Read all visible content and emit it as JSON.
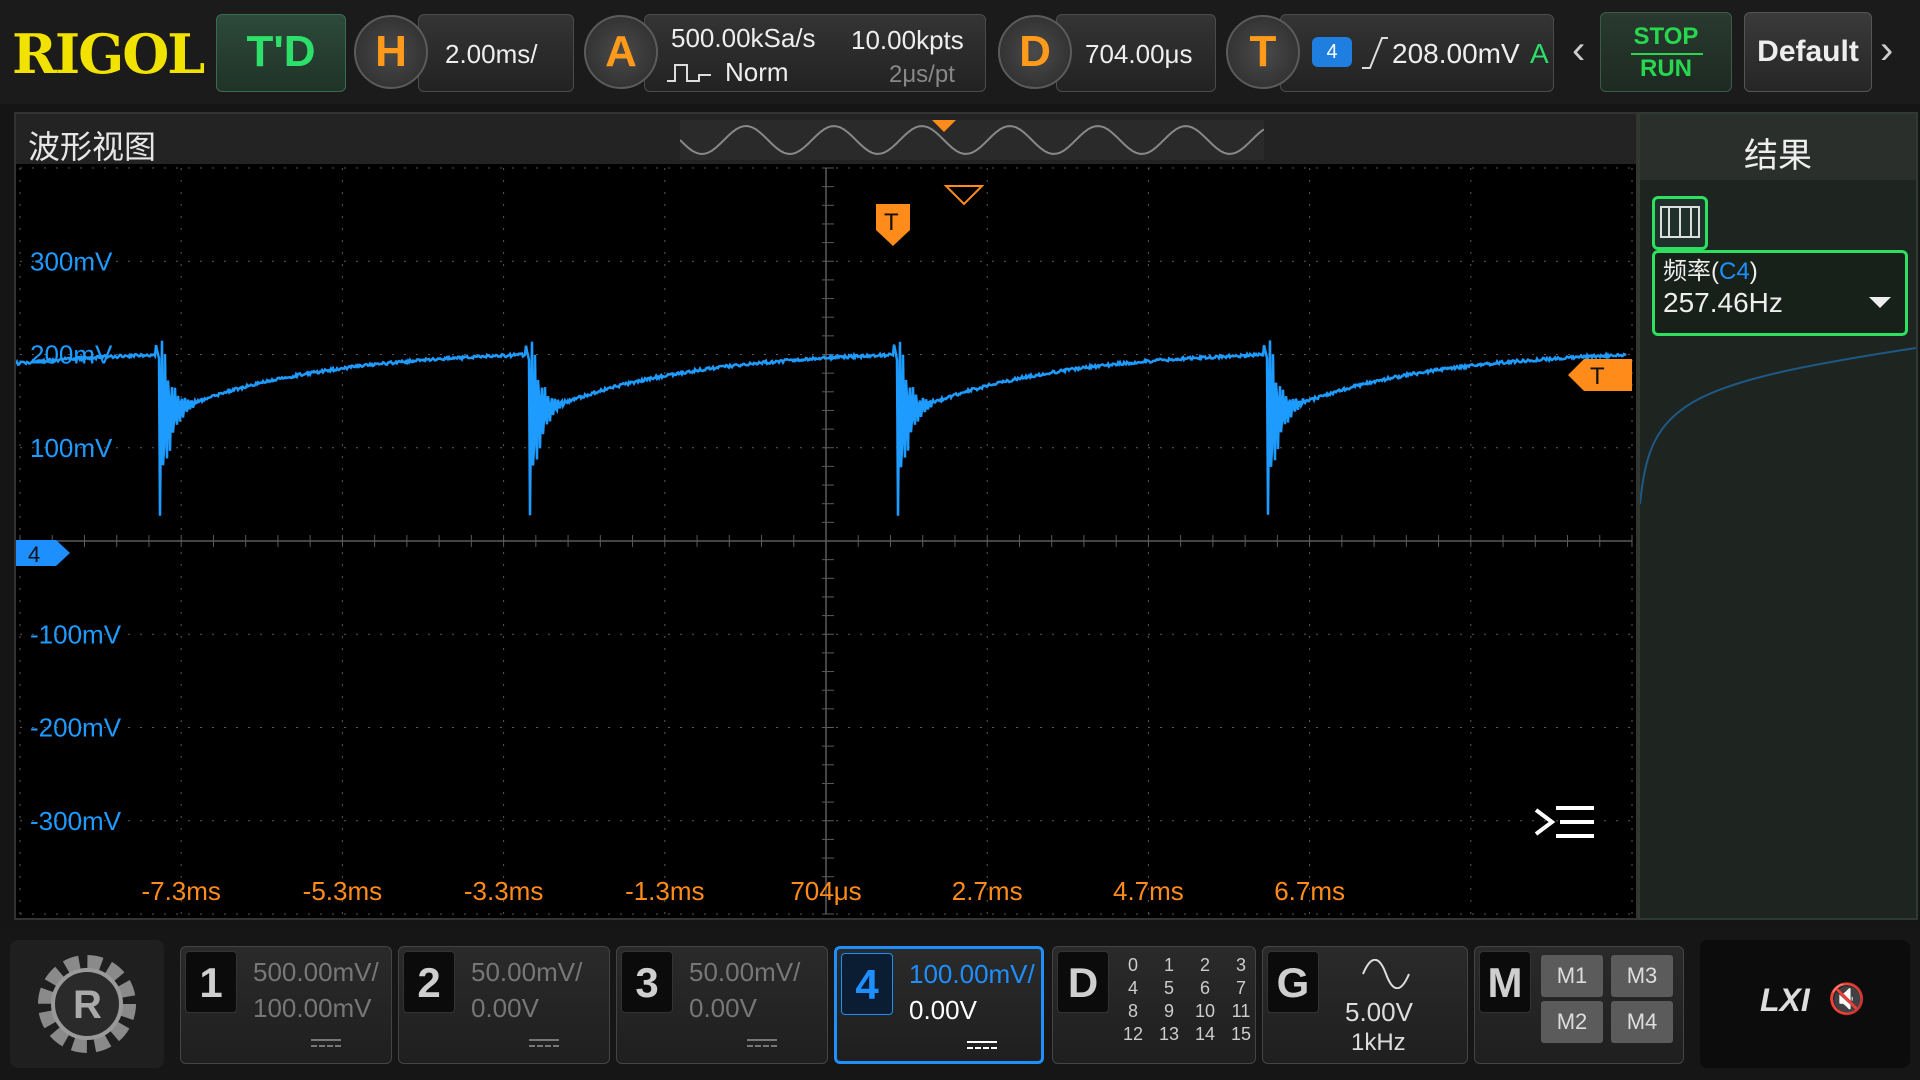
{
  "topbar": {
    "logo": "RIGOL",
    "mode": "T'D",
    "horizontal": {
      "key": "H",
      "timebase": "2.00ms/"
    },
    "acquire": {
      "key": "A",
      "sample_rate": "500.00kSa/s",
      "memory_depth": "10.00kpts",
      "mode": "Norm",
      "resolution": "2μs/pt"
    },
    "delay": {
      "key": "D",
      "value": "704.00μs"
    },
    "trigger": {
      "key": "T",
      "channel": "4",
      "level": "208.00mV",
      "sweep": "A"
    },
    "stop_label": "STOP",
    "run_label": "RUN",
    "default_label": "Default",
    "prev_icon": "chevron-left-icon",
    "next_icon": "chevron-right-icon"
  },
  "waveform": {
    "title": "波形视图",
    "channel_marker": "4",
    "trigger_marker": "T",
    "trigger_level_marker": "T",
    "menu_icon": "collapse-menu-icon",
    "y_labels": [
      "300mV",
      "200mV",
      "100mV",
      "-100mV",
      "-200mV",
      "-300mV"
    ],
    "x_labels": [
      "-7.3ms",
      "-5.3ms",
      "-3.3ms",
      "-1.3ms",
      "704μs",
      "2.7ms",
      "4.7ms",
      "6.7ms"
    ],
    "colors": {
      "trace": "#1e9bff",
      "accent": "#ff8c1a",
      "grid": "#5a5a5a"
    }
  },
  "results": {
    "title": "结果",
    "measurement": {
      "label": "频率",
      "source": "C4",
      "value": "257.46Hz"
    }
  },
  "bottombar": {
    "channels": [
      {
        "num": "1",
        "scale": "500.00mV/",
        "offset": "100.00mV"
      },
      {
        "num": "2",
        "scale": "50.00mV/",
        "offset": "0.00V"
      },
      {
        "num": "3",
        "scale": "50.00mV/",
        "offset": "0.00V"
      },
      {
        "num": "4",
        "scale": "100.00mV/",
        "offset": "0.00V"
      }
    ],
    "digital": {
      "key": "D",
      "bits": [
        "0",
        "1",
        "2",
        "3",
        "4",
        "5",
        "6",
        "7",
        "8",
        "9",
        "10",
        "11",
        "12",
        "13",
        "14",
        "15"
      ]
    },
    "generator": {
      "key": "G",
      "amplitude": "5.00V",
      "frequency": "1kHz",
      "wave_icon": "sine-wave-icon"
    },
    "math": {
      "key": "M",
      "buttons": [
        "M1",
        "M3",
        "M2",
        "M4"
      ]
    },
    "lxi_label": "LXI",
    "speaker_icon": "speaker-muted-icon"
  }
}
